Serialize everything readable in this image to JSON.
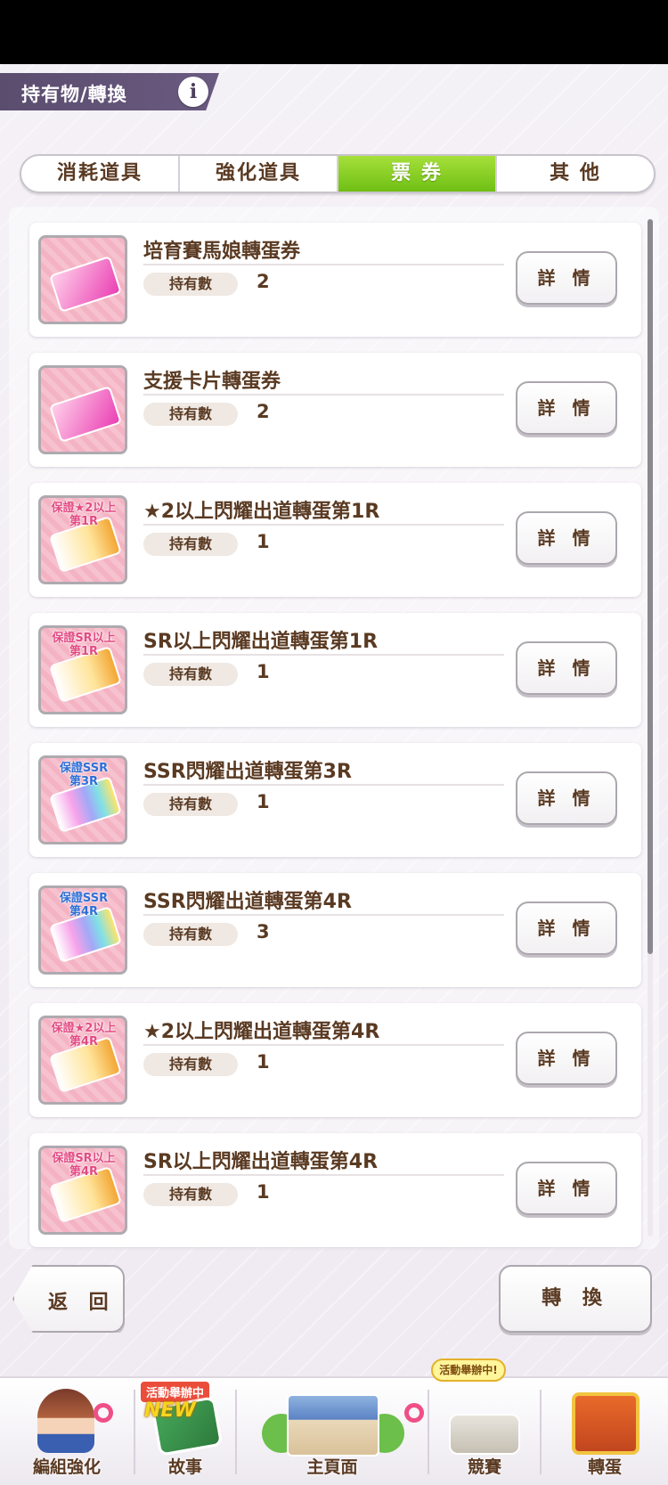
{
  "header": {
    "title": "持有物/轉換",
    "info_icon": "i"
  },
  "tabs": [
    {
      "label": "消耗道具",
      "active": false
    },
    {
      "label": "強化道具",
      "active": false
    },
    {
      "label": "票 券",
      "active": true
    },
    {
      "label": "其 他",
      "active": false
    }
  ],
  "items": [
    {
      "name": "培育賽馬娘轉蛋券",
      "count_label": "持有數",
      "count": "2",
      "details": "詳 情",
      "badge": [
        "",
        ""
      ],
      "style": "pink"
    },
    {
      "name": "支援卡片轉蛋券",
      "count_label": "持有數",
      "count": "2",
      "details": "詳 情",
      "badge": [
        "",
        ""
      ],
      "style": "pink"
    },
    {
      "name": "★2以上閃耀出道轉蛋第1R",
      "count_label": "持有數",
      "count": "1",
      "details": "詳 情",
      "badge": [
        "保證★2以上",
        "第1R"
      ],
      "style": "gold"
    },
    {
      "name": "SR以上閃耀出道轉蛋第1R",
      "count_label": "持有數",
      "count": "1",
      "details": "詳 情",
      "badge": [
        "保證SR以上",
        "第1R"
      ],
      "style": "gold"
    },
    {
      "name": "SSR閃耀出道轉蛋第3R",
      "count_label": "持有數",
      "count": "1",
      "details": "詳 情",
      "badge": [
        "保證SSR",
        "第3R"
      ],
      "style": "rainbow"
    },
    {
      "name": "SSR閃耀出道轉蛋第4R",
      "count_label": "持有數",
      "count": "3",
      "details": "詳 情",
      "badge": [
        "保證SSR",
        "第4R"
      ],
      "style": "rainbow"
    },
    {
      "name": "★2以上閃耀出道轉蛋第4R",
      "count_label": "持有數",
      "count": "1",
      "details": "詳 情",
      "badge": [
        "保證★2以上",
        "第4R"
      ],
      "style": "gold"
    },
    {
      "name": "SR以上閃耀出道轉蛋第4R",
      "count_label": "持有數",
      "count": "1",
      "details": "詳 情",
      "badge": [
        "保證SR以上",
        "第4R"
      ],
      "style": "gold"
    }
  ],
  "buttons": {
    "back": "返 回",
    "convert": "轉 換"
  },
  "nav": {
    "formation": "編組強化",
    "story": "故事",
    "story_tag": "活動舉辦中",
    "story_new": "NEW",
    "home": "主頁面",
    "race": "競賽",
    "race_tag": "活動舉辦中!",
    "gacha": "轉蛋"
  },
  "colors": {
    "active_tab": "#86cc1e",
    "text_brown": "#5a3a22",
    "header_bg": "#5a4d6e"
  }
}
